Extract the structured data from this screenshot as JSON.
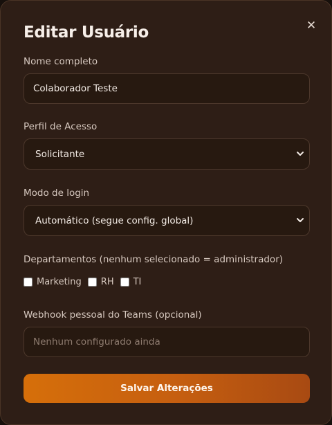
{
  "modal": {
    "title": "Editar Usuário",
    "close_glyph": "✕",
    "close_icon": "close-icon"
  },
  "form": {
    "name": {
      "label": "Nome completo",
      "value": "Colaborador Teste"
    },
    "profile": {
      "label": "Perfil de Acesso",
      "value": "Solicitante",
      "icon": "chevron-down-icon"
    },
    "login_mode": {
      "label": "Modo de login",
      "value": "Automático (segue config. global)",
      "icon": "chevron-down-icon"
    },
    "departments": {
      "label": "Departamentos (nenhum selecionado = administrador)",
      "options": [
        {
          "label": "Marketing",
          "checked": false
        },
        {
          "label": "RH",
          "checked": false
        },
        {
          "label": "TI",
          "checked": false
        }
      ]
    },
    "webhook": {
      "label": "Webhook pessoal do Teams (opcional)",
      "value": "",
      "placeholder": "Nenhum configurado ainda"
    }
  },
  "actions": {
    "save_label": "Salvar Alterações"
  },
  "colors": {
    "background": "#2e1e16",
    "field": "#271910",
    "accent": "#d66f0a"
  }
}
